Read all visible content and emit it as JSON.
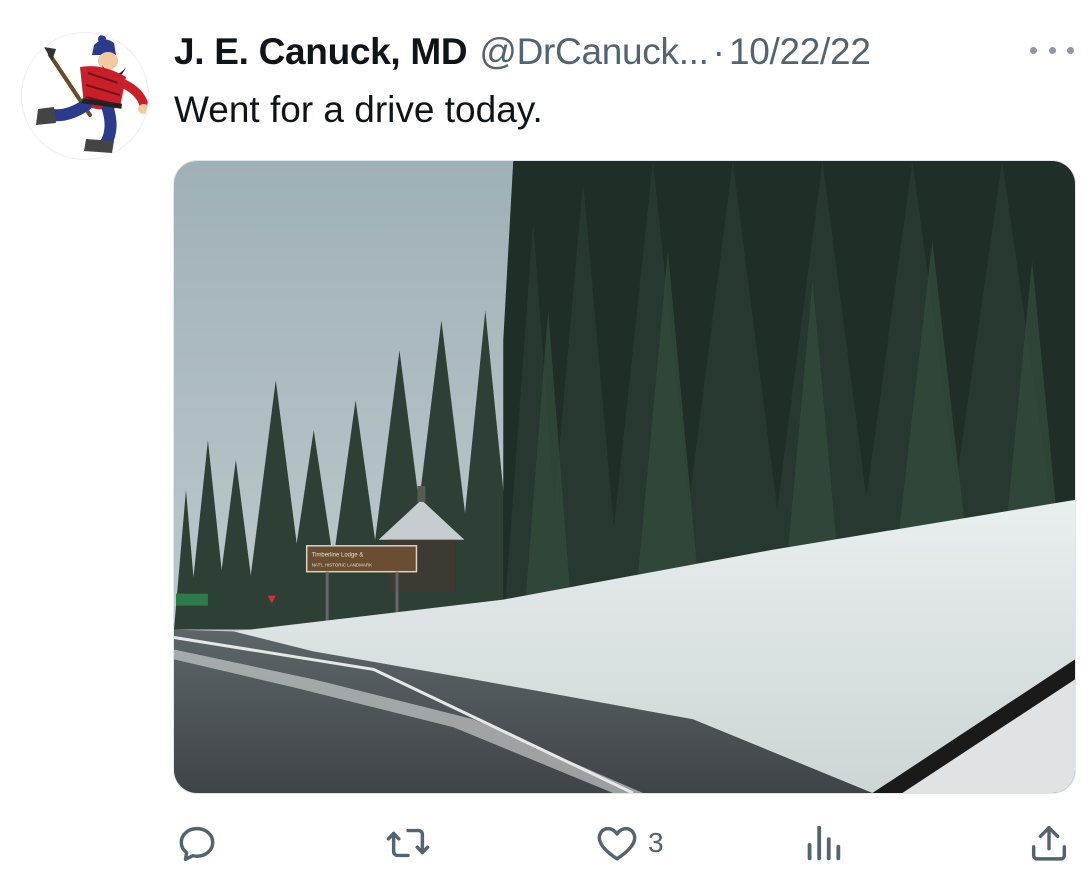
{
  "tweet": {
    "display_name": "J. E. Canuck, MD",
    "handle": "@DrCanuck...",
    "separator": "·",
    "date": "10/22/22",
    "text": "Went for a drive today."
  },
  "media": {
    "sign_line1": "Timberline Lodge &",
    "sign_line2": "NAT'L HISTORIC LANDMARK"
  },
  "actions": {
    "reply": {
      "icon": "reply-icon",
      "count": ""
    },
    "retweet": {
      "icon": "retweet-icon",
      "count": ""
    },
    "like": {
      "icon": "heart-icon",
      "count": "3"
    },
    "views": {
      "icon": "analytics-icon",
      "count": ""
    },
    "share": {
      "icon": "share-icon",
      "count": ""
    }
  },
  "colors": {
    "text_primary": "#0f1419",
    "text_secondary": "#536471"
  }
}
